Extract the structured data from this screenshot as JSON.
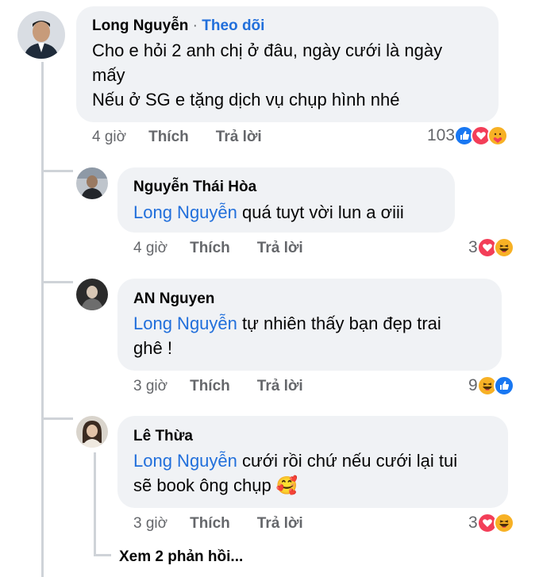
{
  "main_comment": {
    "author": "Long Nguyễn",
    "separator": "·",
    "follow": "Theo dõi",
    "lines": [
      "Cho e hỏi 2 anh chị ở đâu, ngày cưới là ngày",
      "mấy",
      "Nếu ở SG e tặng dịch vụ chụp hình nhé"
    ],
    "time": "4 giờ",
    "like": "Thích",
    "reply": "Trả lời",
    "reaction_count": "103",
    "reactions": [
      "like-icon",
      "love-icon",
      "care-icon"
    ]
  },
  "replies": [
    {
      "author": "Nguyễn Thái Hòa",
      "mention": "Long Nguyễn",
      "lines": [
        " quá tuyt vời lun a ơiii"
      ],
      "time": "4 giờ",
      "like": "Thích",
      "reply": "Trả lời",
      "reaction_count": "3",
      "reactions": [
        "love-icon",
        "haha-icon"
      ]
    },
    {
      "author": "AN Nguyen",
      "mention": "Long Nguyễn",
      "lines": [
        " tự nhiên thấy bạn đẹp trai",
        "ghê !"
      ],
      "time": "3 giờ",
      "like": "Thích",
      "reply": "Trả lời",
      "reaction_count": "9",
      "reactions": [
        "haha-icon",
        "like-icon"
      ]
    },
    {
      "author": "Lê Thừa",
      "mention": "Long Nguyễn",
      "lines": [
        " cưới rồi chứ nếu cưới lại tui",
        "sẽ book ông chụp 🥰"
      ],
      "time": "3 giờ",
      "like": "Thích",
      "reply": "Trả lời",
      "reaction_count": "3",
      "reactions": [
        "love-icon",
        "haha-icon"
      ]
    }
  ],
  "see_more": "Xem 2 phản hồi...",
  "colors": {
    "link": "#216fdb",
    "meta": "#65676b",
    "bubble": "#f0f2f5"
  }
}
